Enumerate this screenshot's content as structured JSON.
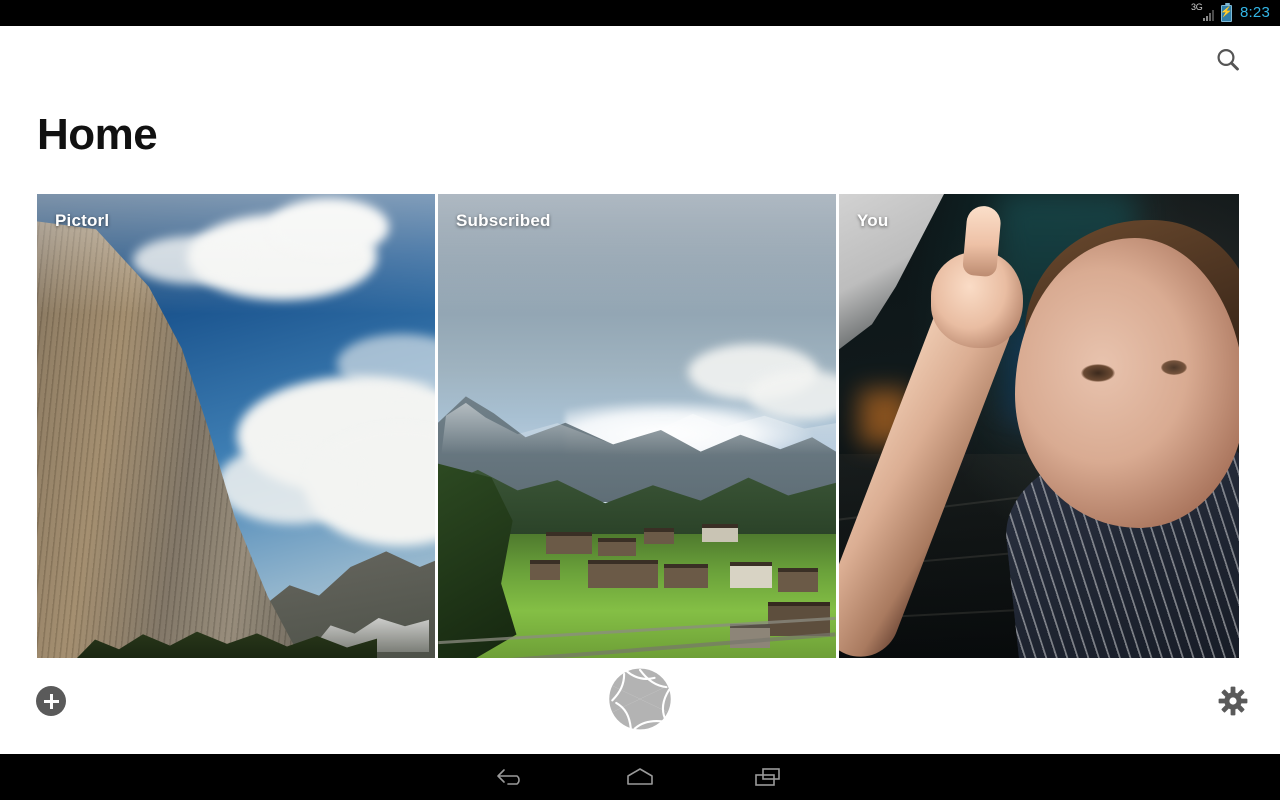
{
  "status_bar": {
    "network_label": "3G",
    "signal_icon": "signal-bars-icon",
    "battery_icon": "battery-charging-icon",
    "time": "8:23",
    "time_color": "#33b5e5",
    "background": "#000000"
  },
  "action_bar": {
    "search_icon": "search-icon",
    "search_label": "Search"
  },
  "page": {
    "title": "Home",
    "background": "#ffffff"
  },
  "cards": [
    {
      "label": "Pictorl",
      "art": "yosemite-granite-cliff-photo",
      "name": "card-pictorl"
    },
    {
      "label": "Subscribed",
      "art": "alpine-valley-village-photo",
      "name": "card-subscribed"
    },
    {
      "label": "You",
      "art": "toddler-pointing-dark-portrait-photo",
      "name": "card-you"
    }
  ],
  "toolbar": {
    "add_icon": "plus-circle-icon",
    "add_label": "Add",
    "shutter_icon": "camera-shutter-icon",
    "shutter_label": "Camera",
    "settings_icon": "gear-icon",
    "settings_label": "Settings",
    "add_color": "#5a5a5a",
    "shutter_color": "#b3b3b3",
    "settings_color": "#5a5a5a"
  },
  "nav_bar": {
    "back_icon": "back-arrow-icon",
    "back_label": "Back",
    "home_icon": "home-icon",
    "home_label": "Home",
    "recents_icon": "recents-icon",
    "recents_label": "Recent apps",
    "background": "#000000"
  }
}
